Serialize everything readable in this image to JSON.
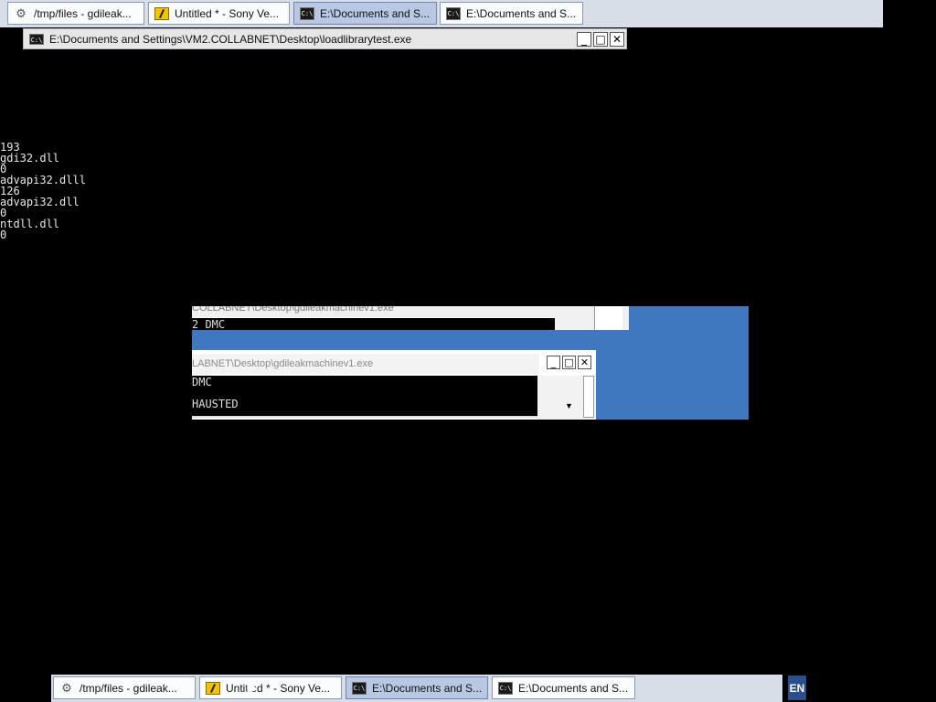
{
  "taskbar_top": {
    "items": [
      {
        "label": "/tmp/files - gdileak...",
        "icon": "gear-icon"
      },
      {
        "label": "Untitled * - Sony Ve...",
        "icon": "sony-vegas-icon"
      },
      {
        "label": "E:\\Documents and S...",
        "icon": "cmd-icon",
        "active": true
      },
      {
        "label": "E:\\Documents and S...",
        "icon": "cmd-icon"
      }
    ]
  },
  "console_window": {
    "title": "E:\\Documents and Settings\\VM2.COLLABNET\\Desktop\\loadlibrarytest.exe",
    "icon_text": "C:\\",
    "min": "_",
    "max": "□",
    "close": "✕"
  },
  "console_output": [
    "193",
    "gdi32.dll",
    "0",
    "advapi32.dlll",
    "126",
    "advapi32.dll",
    "0",
    "ntdll.dll",
    "0"
  ],
  "background_window_1": {
    "title": "COLLABNET\\Desktop\\gdileakmachinev1.exe",
    "line": "2 DMC"
  },
  "background_window_2": {
    "title": "LABNET\\Desktop\\gdileakmachinev1.exe",
    "lines": [
      "DMC",
      "HAUSTED"
    ],
    "min": "_",
    "max": "□",
    "close": "✕"
  },
  "taskbar_bottom": {
    "items": [
      {
        "label": "/tmp/files - gdileak...",
        "icon": "gear-icon"
      },
      {
        "label": "Untitled * - Sony Ve...",
        "icon": "sony-vegas-icon"
      },
      {
        "label": "E:\\Documents and S...",
        "icon": "cmd-icon",
        "active": true
      },
      {
        "label": "E:\\Documents and S...",
        "icon": "cmd-icon"
      }
    ],
    "language": "EN"
  }
}
